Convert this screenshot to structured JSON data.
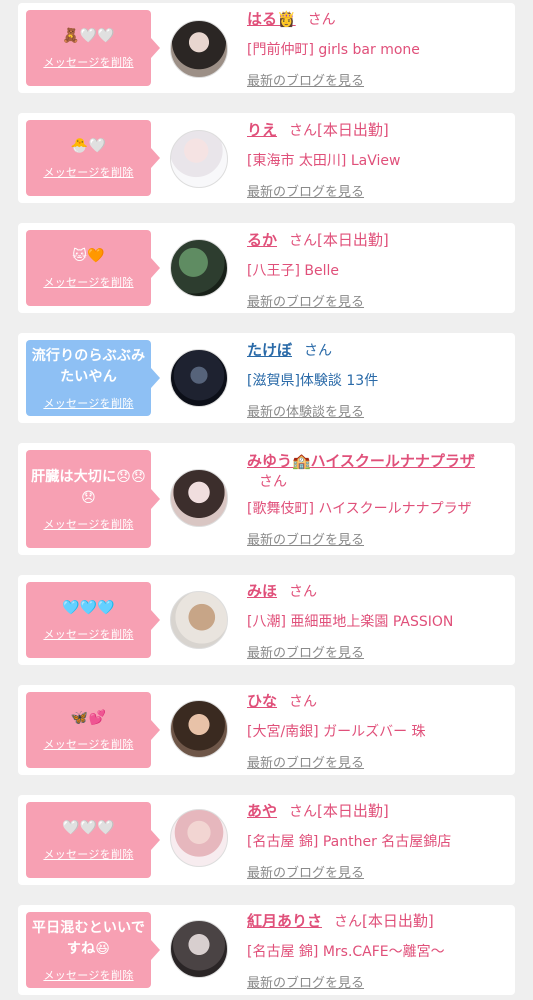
{
  "delete_label": "メッセージを削除",
  "messages": [
    {
      "bubble": "🧸🤍🤍",
      "name": "はる👸",
      "san": "さん",
      "status": "",
      "shop": "[門前仲町] girls bar mone",
      "link": "最新のブログを見る"
    },
    {
      "bubble": "🐣🤍",
      "name": "りえ",
      "san": "さん",
      "status": "[本日出勤]",
      "shop": "[東海市 太田川] LaView",
      "link": "最新のブログを見る"
    },
    {
      "bubble": "🐱🧡",
      "name": "るか",
      "san": "さん",
      "status": "[本日出勤]",
      "shop": "[八王子] Belle",
      "link": "最新のブログを見る"
    },
    {
      "bubble": "流行りのらぶぶみたいやん",
      "name": "たけぼ",
      "san": "さん",
      "status": "",
      "shop": "[滋賀県]体験談 13件",
      "link": "最新の体験談を見る"
    },
    {
      "bubble": "肝臓は大切に😞😞😞",
      "name": "みゆう🏫ハイスクールナナプラザ",
      "san": "さん",
      "status": "",
      "shop": "[歌舞伎町] ハイスクールナナプラザ",
      "link": "最新のブログを見る"
    },
    {
      "bubble": "🩵🩵🩵",
      "name": "みほ",
      "san": "さん",
      "status": "",
      "shop": "[八潮] 亜細亜地上楽園 PASSION",
      "link": "最新のブログを見る"
    },
    {
      "bubble": "🦋💕",
      "name": "ひな",
      "san": "さん",
      "status": "",
      "shop": "[大宮/南銀] ガールズバー 珠",
      "link": "最新のブログを見る"
    },
    {
      "bubble": "🤍🤍🤍",
      "name": "あや",
      "san": "さん",
      "status": "[本日出勤]",
      "shop": "[名古屋 錦] Panther 名古屋錦店",
      "link": "最新のブログを見る"
    },
    {
      "bubble": "平日混むといいですね😆",
      "name": "紅月ありさ",
      "san": "さん",
      "status": "[本日出勤]",
      "shop": "[名古屋 錦] Mrs.CAFE〜離宮〜",
      "link": "最新のブログを見る"
    }
  ]
}
